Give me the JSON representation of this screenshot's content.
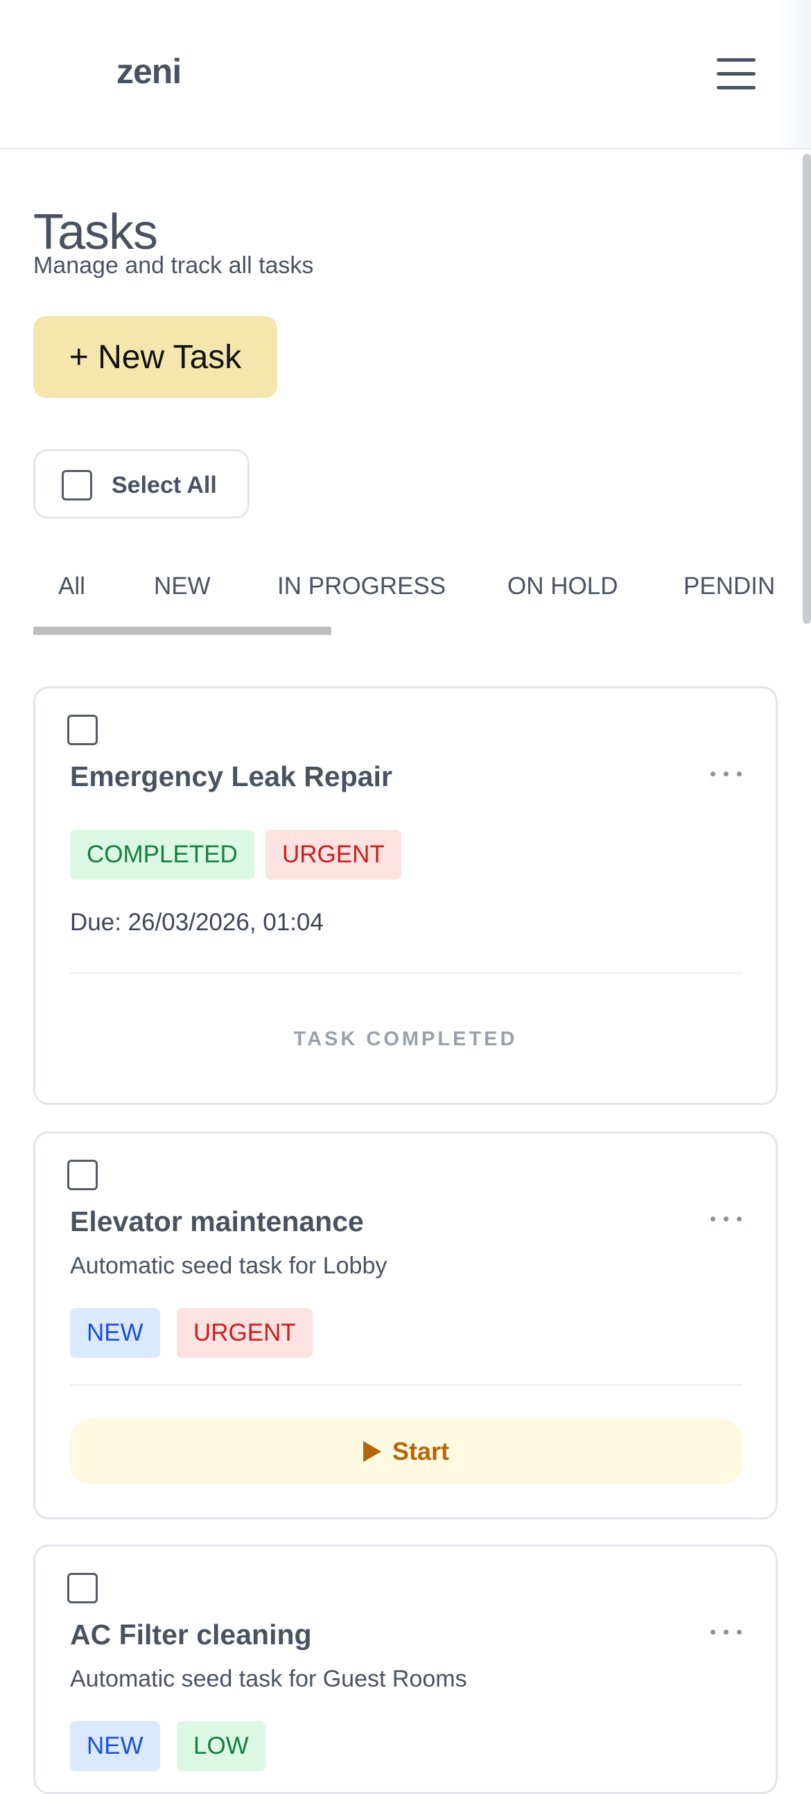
{
  "header": {
    "logo": "zeni",
    "menu_icon": "hamburger-menu-icon"
  },
  "page": {
    "title": "Tasks",
    "subtitle": "Manage and track all tasks"
  },
  "actions": {
    "new_task_label": "+ New Task",
    "select_all_label": "Select All"
  },
  "tabs": [
    {
      "label": "All",
      "active": true
    },
    {
      "label": "NEW"
    },
    {
      "label": "IN PROGRESS"
    },
    {
      "label": "ON HOLD"
    },
    {
      "label": "PENDING"
    }
  ],
  "tasks": [
    {
      "title": "Emergency Leak Repair",
      "description": "",
      "status": "COMPLETED",
      "priority": "URGENT",
      "due": "Due: 26/03/2026, 01:04",
      "footer": "TASK COMPLETED"
    },
    {
      "title": "Elevator maintenance",
      "description": "Automatic seed task for Lobby",
      "status": "NEW",
      "priority": "URGENT",
      "action": "Start"
    },
    {
      "title": "AC Filter cleaning",
      "description": "Automatic seed task for Guest Rooms",
      "status": "NEW",
      "priority": "LOW"
    }
  ],
  "colors": {
    "primary_button": "#f5e6ae",
    "completed_badge_bg": "#dcf7e4",
    "urgent_badge_bg": "#fde2e2",
    "new_badge_bg": "#dbe9fe",
    "start_button_bg": "#fef9e0",
    "start_button_text": "#b3670a"
  }
}
